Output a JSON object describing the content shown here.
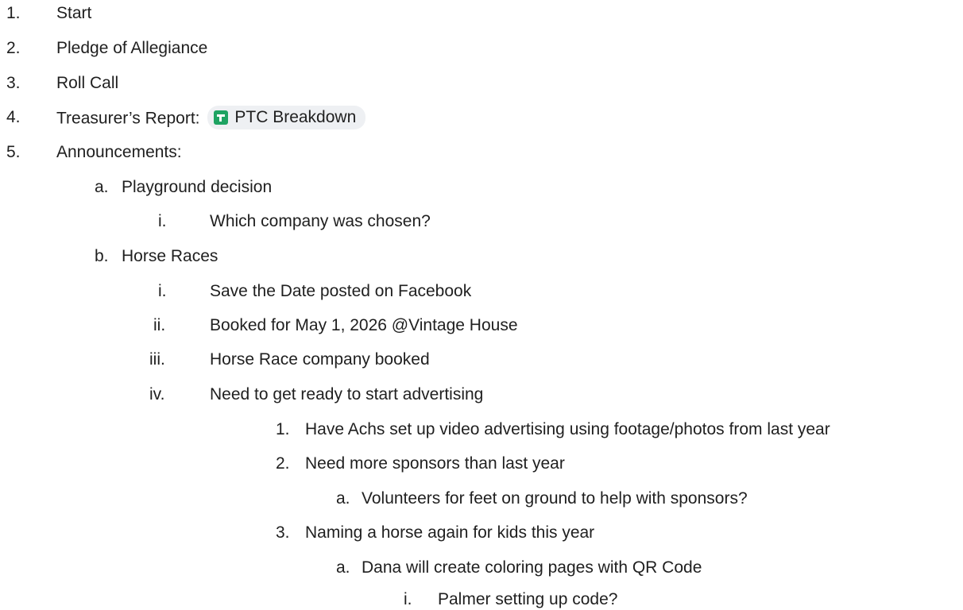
{
  "outline": [
    {
      "marker": "1.",
      "text": "Start"
    },
    {
      "marker": "2.",
      "text": "Pledge of Allegiance"
    },
    {
      "marker": "3.",
      "text": "Roll Call"
    },
    {
      "marker": "4.",
      "text": "Treasurer’s Report:",
      "chip": {
        "icon": "google-sheets-icon",
        "label": "PTC Breakdown"
      }
    },
    {
      "marker": "5.",
      "text": "Announcements:"
    },
    {
      "marker": "a.",
      "text": "Playground decision"
    },
    {
      "marker": "i.",
      "text": "Which company was chosen?"
    },
    {
      "marker": "b.",
      "text": "Horse Races"
    },
    {
      "marker": "i.",
      "text": "Save the Date posted on Facebook"
    },
    {
      "marker": "ii.",
      "text": "Booked for May 1, 2026 @Vintage House"
    },
    {
      "marker": "iii.",
      "text": "Horse Race company booked"
    },
    {
      "marker": "iv.",
      "text": "Need to get ready to start advertising"
    },
    {
      "marker": "1.",
      "text": "Have Achs set up video advertising using footage/photos from last year"
    },
    {
      "marker": "2.",
      "text": "Need more sponsors than last year"
    },
    {
      "marker": "a.",
      "text": "Volunteers for feet on ground to help with sponsors?"
    },
    {
      "marker": "3.",
      "text": "Naming a horse again for kids this year"
    },
    {
      "marker": "a.",
      "text": "Dana will create coloring pages with QR Code"
    },
    {
      "marker": "i.",
      "text": "Palmer setting up code?"
    }
  ]
}
